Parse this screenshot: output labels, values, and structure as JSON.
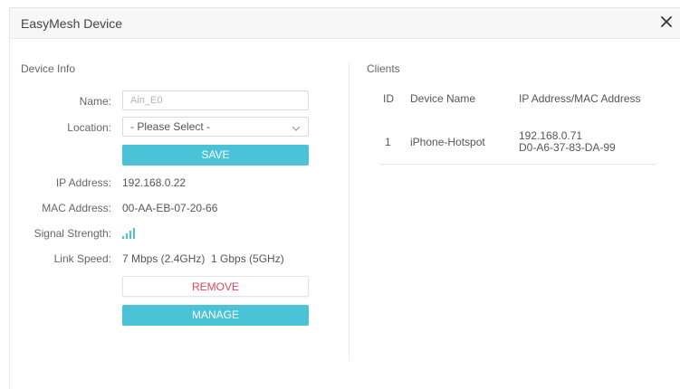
{
  "dialog": {
    "title": "EasyMesh Device",
    "close_label": "×"
  },
  "device_info": {
    "section_label": "Device Info",
    "name_label": "Name:",
    "name_value": "Ain_E0",
    "location_label": "Location:",
    "location_selected": "- Please Select -",
    "save_label": "SAVE",
    "ip_label": "IP Address:",
    "ip_value": "192.168.0.22",
    "mac_label": "MAC Address:",
    "mac_value": "00-AA-EB-07-20-66",
    "signal_label": "Signal Strength:",
    "signal_bars": 4,
    "signal_color": "#4ac3d9",
    "link_label": "Link Speed:",
    "link_value": "7 Mbps (2.4GHz)  1 Gbps (5GHz)",
    "remove_label": "REMOVE",
    "manage_label": "MANAGE"
  },
  "clients": {
    "section_label": "Clients",
    "columns": [
      "ID",
      "Device Name",
      "IP Address/MAC Address"
    ],
    "rows": [
      {
        "id": "1",
        "device_name": "iPhone-Hotspot",
        "ip": "192.168.0.71",
        "mac": "D0-A6-37-83-DA-99"
      }
    ]
  },
  "colors": {
    "accent": "#4ac3d9",
    "remove": "#e0435e"
  }
}
